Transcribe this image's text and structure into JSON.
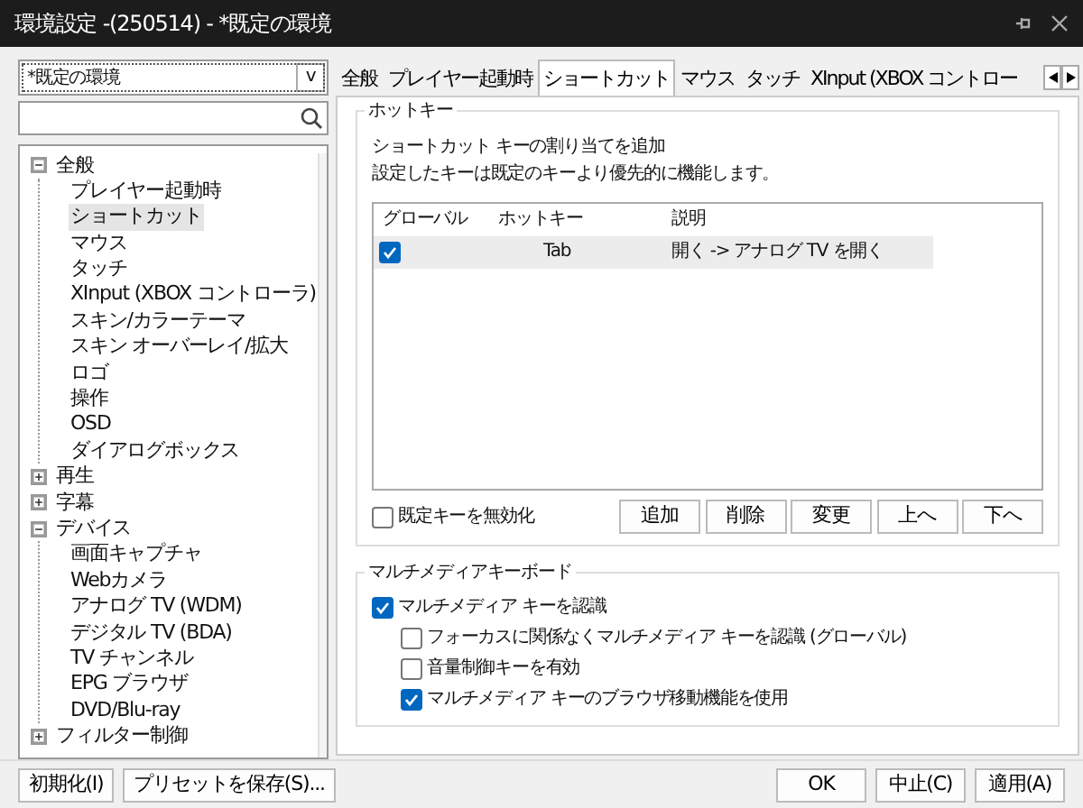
{
  "window": {
    "title": "環境設定 -(250514) - *既定の環境"
  },
  "preset_dropdown": {
    "value": "*既定の環境",
    "caret": "v"
  },
  "tree": [
    {
      "label": "全般",
      "expanded": true,
      "selected": false,
      "children": [
        {
          "label": "プレイヤー起動時",
          "selected": false
        },
        {
          "label": "ショートカット",
          "selected": true
        },
        {
          "label": "マウス",
          "selected": false
        },
        {
          "label": "タッチ",
          "selected": false
        },
        {
          "label": "XInput (XBOX コントローラ)",
          "selected": false
        },
        {
          "label": "スキン/カラーテーマ",
          "selected": false
        },
        {
          "label": "スキン オーバーレイ/拡大",
          "selected": false
        },
        {
          "label": "ロゴ",
          "selected": false
        },
        {
          "label": "操作",
          "selected": false
        },
        {
          "label": "OSD",
          "selected": false
        },
        {
          "label": "ダイアログボックス",
          "selected": false
        }
      ]
    },
    {
      "label": "再生",
      "expanded": false,
      "selected": false
    },
    {
      "label": "字幕",
      "expanded": false,
      "selected": false
    },
    {
      "label": "デバイス",
      "expanded": true,
      "selected": false,
      "children": [
        {
          "label": "画面キャプチャ",
          "selected": false
        },
        {
          "label": "Webカメラ",
          "selected": false
        },
        {
          "label": "アナログ TV (WDM)",
          "selected": false
        },
        {
          "label": "デジタル TV (BDA)",
          "selected": false
        },
        {
          "label": "TV チャンネル",
          "selected": false
        },
        {
          "label": "EPG ブラウザ",
          "selected": false
        },
        {
          "label": "DVD/Blu-ray",
          "selected": false
        }
      ]
    },
    {
      "label": "フィルター制御",
      "expanded": false,
      "selected": false
    }
  ],
  "tabs": [
    {
      "label": "全般",
      "selected": false
    },
    {
      "label": "プレイヤー起動時",
      "selected": false
    },
    {
      "label": "ショートカット",
      "selected": true
    },
    {
      "label": "マウス",
      "selected": false
    },
    {
      "label": "タッチ",
      "selected": false
    },
    {
      "label": "XInput (XBOX コントロー",
      "selected": false
    }
  ],
  "hotkey_group": {
    "title": "ホットキー",
    "description": [
      "ショートカット キーの割り当てを追加",
      "設定したキーは既定のキーより優先的に機能します。"
    ],
    "table": {
      "columns": [
        "グローバル",
        "ホットキー",
        "説明"
      ],
      "rows": [
        {
          "global": true,
          "hotkey": "Tab",
          "description": "開く -> アナログ TV を開く",
          "selected": true
        }
      ]
    },
    "disable_defaults": {
      "label": "既定キーを無効化",
      "checked": false
    },
    "buttons": [
      "追加",
      "削除",
      "変更",
      "上へ",
      "下へ"
    ]
  },
  "multimedia_group": {
    "title": "マルチメディアキーボード",
    "options": [
      {
        "label": "マルチメディア キーを認識",
        "checked": true,
        "children": [
          {
            "label": "フォーカスに関係なくマルチメディア キーを認識 (グローバル)",
            "checked": false
          },
          {
            "label": "音量制御キーを有効",
            "checked": false
          },
          {
            "label": "マルチメディア キーのブラウザ移動機能を使用",
            "checked": true
          }
        ]
      }
    ]
  },
  "footer": {
    "left_buttons": [
      "初期化(I)",
      "プリセットを保存(S)..."
    ],
    "right_buttons": [
      "OK",
      "中止(C)",
      "適用(A)"
    ]
  }
}
